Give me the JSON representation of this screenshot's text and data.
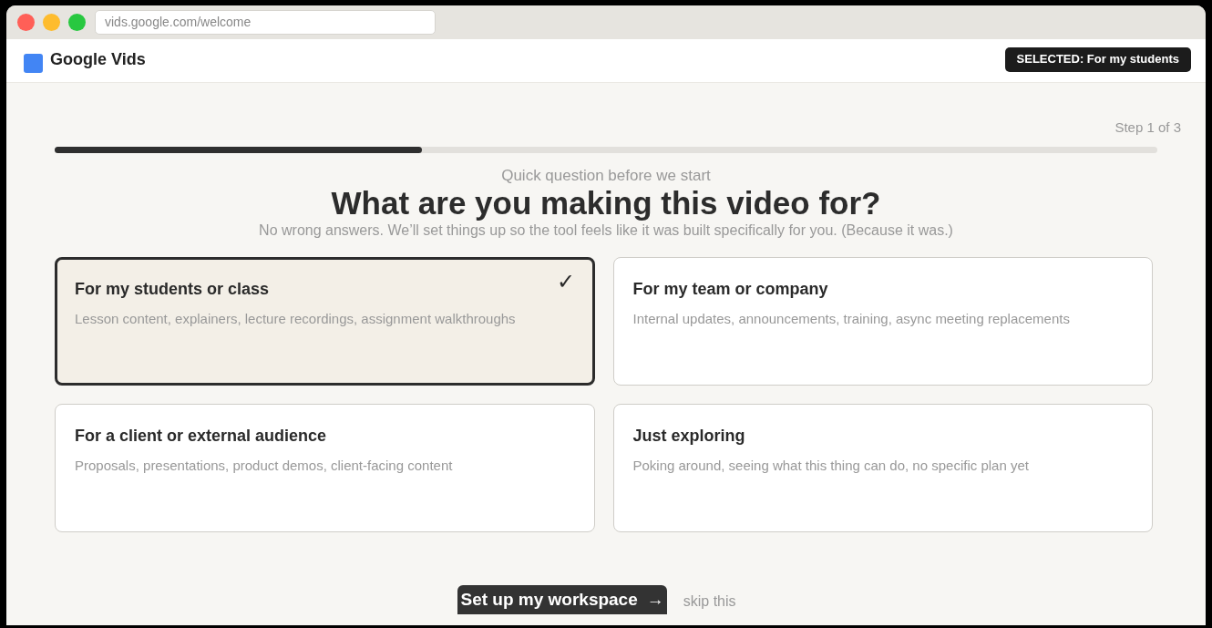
{
  "browser": {
    "url": "vids.google.com/welcome"
  },
  "header": {
    "app_name": "Google Vids",
    "selected_badge": "SELECTED: For my students"
  },
  "progress": {
    "step": "Step 1 of 3",
    "level": 0.333
  },
  "intro": {
    "kicker": "Quick question before we start",
    "title": "What are you making this video for?",
    "subtitle": "No wrong answers. We’ll set things up so the tool feels like it was built specifically for you. (Because it was.)"
  },
  "options": [
    {
      "title": "For my students or class",
      "description": "Lesson content, explainers, lecture recordings, assignment walkthroughs",
      "selected": true,
      "check": "✓"
    },
    {
      "title": "For my team or company",
      "description": "Internal updates, announcements, training, async meeting replacements",
      "selected": false
    },
    {
      "title": "For a client or external audience",
      "description": "Proposals, presentations, product demos, client-facing content",
      "selected": false
    },
    {
      "title": "Just exploring",
      "description": "Poking around, seeing what this thing can do, no specific plan yet",
      "selected": false
    }
  ],
  "actions": {
    "primary": "Set up my workspace",
    "primary_arrow": "→",
    "skip": "skip this"
  }
}
